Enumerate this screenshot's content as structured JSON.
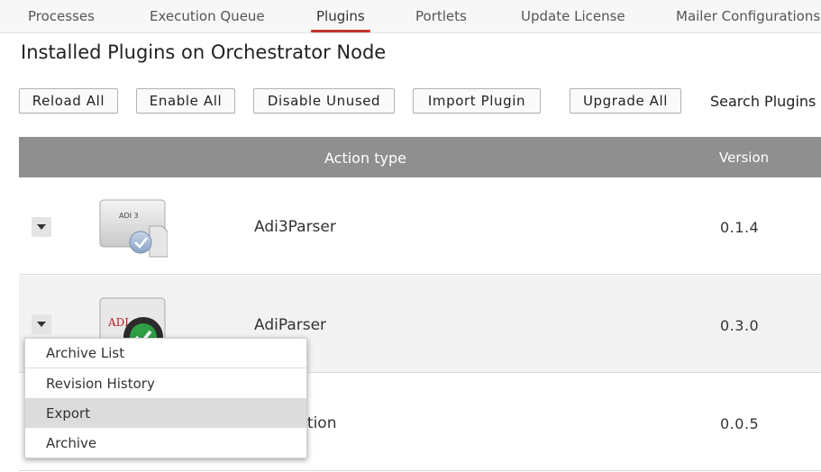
{
  "nav": {
    "tabs": [
      {
        "label": "Processes"
      },
      {
        "label": "Execution Queue"
      },
      {
        "label": "Plugins"
      },
      {
        "label": "Portlets"
      },
      {
        "label": "Update License"
      },
      {
        "label": "Mailer Configurations"
      }
    ],
    "active": "Plugins"
  },
  "page": {
    "title": "Installed Plugins on Orchestrator Node"
  },
  "toolbar": {
    "reload_all": "Reload All",
    "enable_all": "Enable All",
    "disable_unused": "Disable Unused",
    "import_plugin": "Import Plugin",
    "upgrade_all": "Upgrade All",
    "search_label": "Search Plugins"
  },
  "table": {
    "headers": {
      "action_type": "Action type",
      "version": "Version"
    },
    "rows": [
      {
        "name": "Adi3Parser",
        "version": "0.1.4",
        "icon": "adi3-document-check-icon",
        "icon_text": "ADI 3"
      },
      {
        "name": "AdiParser",
        "version": "0.3.0",
        "icon": "adi-green-check-icon",
        "icon_text": "ADI"
      },
      {
        "name": "sformation",
        "version": "0.0.5",
        "icon": "hidden"
      }
    ]
  },
  "context_menu": {
    "items": [
      {
        "label": "Archive List"
      },
      {
        "label": "Revision History"
      },
      {
        "label": "Export"
      },
      {
        "label": "Archive"
      }
    ],
    "highlighted": "Export"
  },
  "colors": {
    "accent": "#c0392b",
    "header_bg": "#8f8f8f",
    "row_alt_bg": "#f2f2f2",
    "menu_highlight": "#dcdcdc"
  }
}
